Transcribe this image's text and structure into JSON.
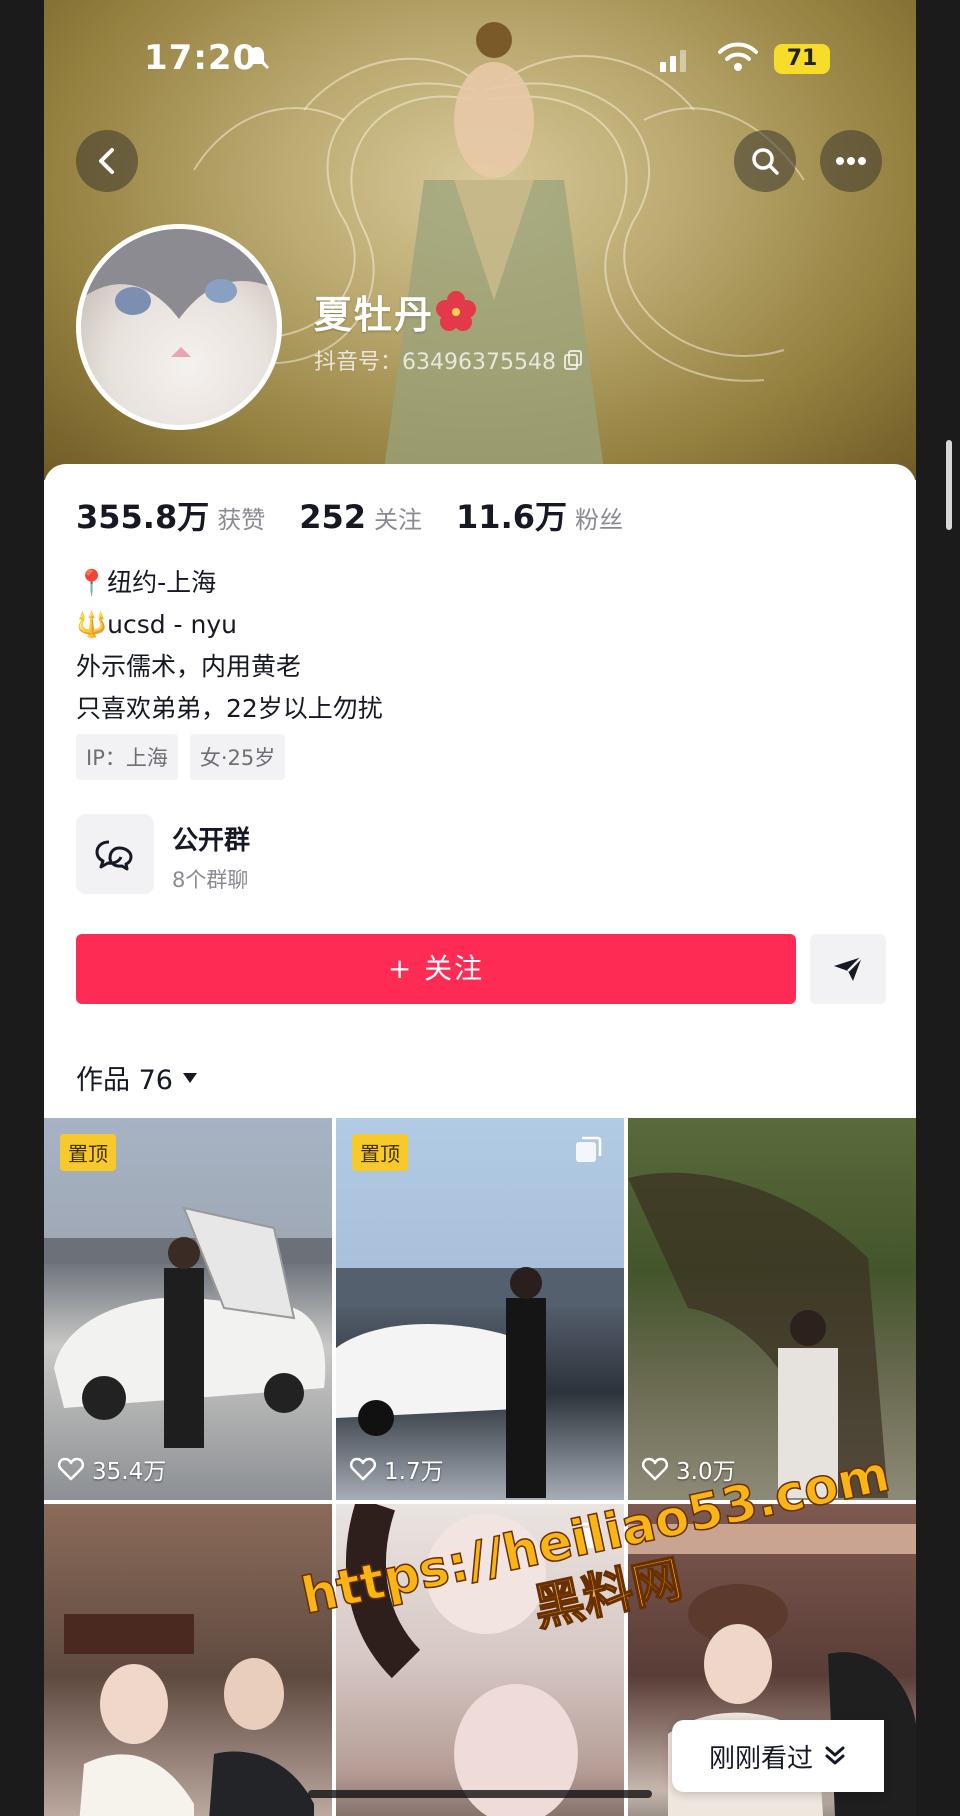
{
  "status_bar": {
    "time": "17:20",
    "battery": "71"
  },
  "profile": {
    "name": "夏牡丹",
    "douyin_id": "抖音号：63496375548",
    "stats": [
      {
        "num": "355.8万",
        "label": "获赞"
      },
      {
        "num": "252",
        "label": "关注"
      },
      {
        "num": "11.6万",
        "label": "粉丝"
      }
    ],
    "bio": [
      "📍纽约-上海",
      "🔱ucsd - nyu",
      "外示儒术，内用黄老",
      "只喜欢弟弟，22岁以上勿扰"
    ],
    "tags": [
      "IP：上海",
      "女·25岁"
    ],
    "group": {
      "title": "公开群",
      "subtitle": "8个群聊"
    },
    "follow_label": "+ 关注"
  },
  "works": {
    "label": "作品 76",
    "items": [
      {
        "pin": "置顶",
        "likes": "35.4万"
      },
      {
        "pin": "置顶",
        "likes": "1.7万"
      },
      {
        "pin": "",
        "likes": "3.0万"
      },
      {
        "pin": "",
        "likes": ""
      },
      {
        "pin": "",
        "likes": ""
      },
      {
        "pin": "",
        "likes": ""
      }
    ]
  },
  "watermark": {
    "line1": "https://heiliao53.com",
    "line2": "黑料网"
  },
  "recent_label": "刚刚看过",
  "colors": {
    "accent": "#fe2c55",
    "pin": "#f8c92a"
  }
}
